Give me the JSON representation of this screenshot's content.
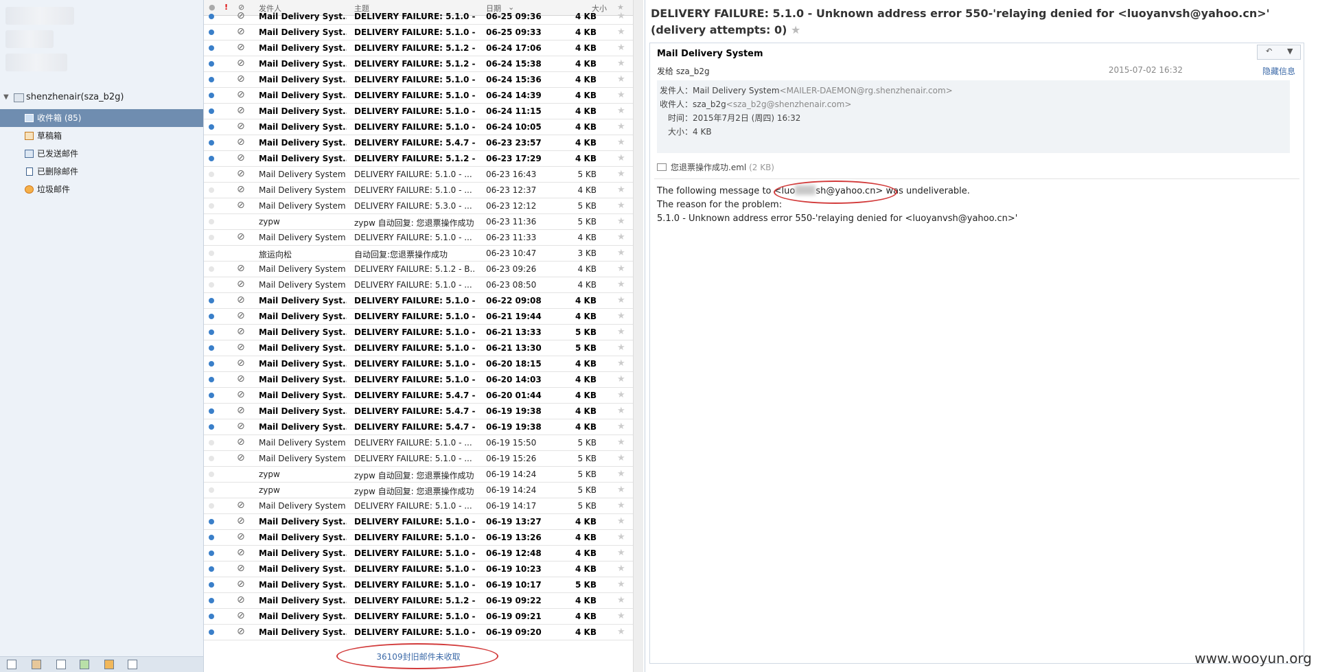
{
  "sidebar": {
    "account": "shenzhenair(sza_b2g)",
    "folders": [
      {
        "label": "收件箱 (85)",
        "icon": "inbox-icon",
        "selected": true
      },
      {
        "label": "草稿箱",
        "icon": "drafts-icon",
        "selected": false
      },
      {
        "label": "已发送邮件",
        "icon": "sent-icon",
        "selected": false
      },
      {
        "label": "已删除邮件",
        "icon": "trash-icon",
        "selected": false
      },
      {
        "label": "垃圾邮件",
        "icon": "junk-icon",
        "selected": false
      }
    ],
    "bottom_icons": [
      "mail-icon",
      "contacts-icon",
      "calendar-icon",
      "notes-icon",
      "rss-icon",
      "settings-icon"
    ]
  },
  "list": {
    "columns": {
      "from": "发件人",
      "subject": "主题",
      "date": "日期",
      "size": "大小"
    },
    "rows": [
      {
        "from": "Mail Delivery Syst...",
        "subject": "DELIVERY FAILURE: 5.1.0 - ...",
        "date": "06-25 09:36",
        "size": "4 KB",
        "unread": true,
        "attach": true
      },
      {
        "from": "Mail Delivery Syst...",
        "subject": "DELIVERY FAILURE: 5.1.0 - ...",
        "date": "06-25 09:33",
        "size": "4 KB",
        "unread": true,
        "attach": true
      },
      {
        "from": "Mail Delivery Syst...",
        "subject": "DELIVERY FAILURE: 5.1.2 - ...",
        "date": "06-24 17:06",
        "size": "4 KB",
        "unread": true,
        "attach": true
      },
      {
        "from": "Mail Delivery Syst...",
        "subject": "DELIVERY FAILURE: 5.1.2 - ...",
        "date": "06-24 15:38",
        "size": "4 KB",
        "unread": true,
        "attach": true
      },
      {
        "from": "Mail Delivery Syst...",
        "subject": "DELIVERY FAILURE: 5.1.0 - ...",
        "date": "06-24 15:36",
        "size": "4 KB",
        "unread": true,
        "attach": true
      },
      {
        "from": "Mail Delivery Syst...",
        "subject": "DELIVERY FAILURE: 5.1.0 - ...",
        "date": "06-24 14:39",
        "size": "4 KB",
        "unread": true,
        "attach": true
      },
      {
        "from": "Mail Delivery Syst...",
        "subject": "DELIVERY FAILURE: 5.1.0 - ...",
        "date": "06-24 11:15",
        "size": "4 KB",
        "unread": true,
        "attach": true
      },
      {
        "from": "Mail Delivery Syst...",
        "subject": "DELIVERY FAILURE: 5.1.0 - ...",
        "date": "06-24 10:05",
        "size": "4 KB",
        "unread": true,
        "attach": true
      },
      {
        "from": "Mail Delivery Syst...",
        "subject": "DELIVERY FAILURE: 5.4.7 - ...",
        "date": "06-23 23:57",
        "size": "4 KB",
        "unread": true,
        "attach": true
      },
      {
        "from": "Mail Delivery Syst...",
        "subject": "DELIVERY FAILURE: 5.1.2 - ...",
        "date": "06-23 17:29",
        "size": "4 KB",
        "unread": true,
        "attach": true
      },
      {
        "from": "Mail Delivery System",
        "subject": "DELIVERY FAILURE: 5.1.0 - ...",
        "date": "06-23 16:43",
        "size": "5 KB",
        "unread": false,
        "attach": true
      },
      {
        "from": "Mail Delivery System",
        "subject": "DELIVERY FAILURE: 5.1.0 - ...",
        "date": "06-23 12:37",
        "size": "4 KB",
        "unread": false,
        "attach": true
      },
      {
        "from": "Mail Delivery System",
        "subject": "DELIVERY FAILURE: 5.3.0 - ...",
        "date": "06-23 12:12",
        "size": "5 KB",
        "unread": false,
        "attach": true
      },
      {
        "from": "zypw",
        "subject": "zypw 自动回复: 您退票操作成功",
        "date": "06-23 11:36",
        "size": "5 KB",
        "unread": false,
        "attach": false
      },
      {
        "from": "Mail Delivery System",
        "subject": "DELIVERY FAILURE: 5.1.0 - ...",
        "date": "06-23 11:33",
        "size": "4 KB",
        "unread": false,
        "attach": true
      },
      {
        "from": "旅运向松",
        "subject": "自动回复:您退票操作成功",
        "date": "06-23 10:47",
        "size": "3 KB",
        "unread": false,
        "attach": false
      },
      {
        "from": "Mail Delivery System",
        "subject": "DELIVERY FAILURE: 5.1.2 - B...",
        "date": "06-23 09:26",
        "size": "4 KB",
        "unread": false,
        "attach": true
      },
      {
        "from": "Mail Delivery System",
        "subject": "DELIVERY FAILURE: 5.1.0 - ...",
        "date": "06-23 08:50",
        "size": "4 KB",
        "unread": false,
        "attach": true
      },
      {
        "from": "Mail Delivery Syst...",
        "subject": "DELIVERY FAILURE: 5.1.0 - ...",
        "date": "06-22 09:08",
        "size": "4 KB",
        "unread": true,
        "attach": true
      },
      {
        "from": "Mail Delivery Syst...",
        "subject": "DELIVERY FAILURE: 5.1.0 - ...",
        "date": "06-21 19:44",
        "size": "4 KB",
        "unread": true,
        "attach": true
      },
      {
        "from": "Mail Delivery Syst...",
        "subject": "DELIVERY FAILURE: 5.1.0 - ...",
        "date": "06-21 13:33",
        "size": "5 KB",
        "unread": true,
        "attach": true
      },
      {
        "from": "Mail Delivery Syst...",
        "subject": "DELIVERY FAILURE: 5.1.0 - ...",
        "date": "06-21 13:30",
        "size": "5 KB",
        "unread": true,
        "attach": true
      },
      {
        "from": "Mail Delivery Syst...",
        "subject": "DELIVERY FAILURE: 5.1.0 - ...",
        "date": "06-20 18:15",
        "size": "4 KB",
        "unread": true,
        "attach": true
      },
      {
        "from": "Mail Delivery Syst...",
        "subject": "DELIVERY FAILURE: 5.1.0 - ...",
        "date": "06-20 14:03",
        "size": "4 KB",
        "unread": true,
        "attach": true
      },
      {
        "from": "Mail Delivery Syst...",
        "subject": "DELIVERY FAILURE: 5.4.7 - ...",
        "date": "06-20 01:44",
        "size": "4 KB",
        "unread": true,
        "attach": true
      },
      {
        "from": "Mail Delivery Syst...",
        "subject": "DELIVERY FAILURE: 5.4.7 - ...",
        "date": "06-19 19:38",
        "size": "4 KB",
        "unread": true,
        "attach": true
      },
      {
        "from": "Mail Delivery Syst...",
        "subject": "DELIVERY FAILURE: 5.4.7 - ...",
        "date": "06-19 19:38",
        "size": "4 KB",
        "unread": true,
        "attach": true
      },
      {
        "from": "Mail Delivery System",
        "subject": "DELIVERY FAILURE: 5.1.0 - ...",
        "date": "06-19 15:50",
        "size": "5 KB",
        "unread": false,
        "attach": true
      },
      {
        "from": "Mail Delivery System",
        "subject": "DELIVERY FAILURE: 5.1.0 - ...",
        "date": "06-19 15:26",
        "size": "5 KB",
        "unread": false,
        "attach": true
      },
      {
        "from": "zypw",
        "subject": "zypw 自动回复: 您退票操作成功",
        "date": "06-19 14:24",
        "size": "5 KB",
        "unread": false,
        "attach": false
      },
      {
        "from": "zypw",
        "subject": "zypw 自动回复: 您退票操作成功",
        "date": "06-19 14:24",
        "size": "5 KB",
        "unread": false,
        "attach": false
      },
      {
        "from": "Mail Delivery System",
        "subject": "DELIVERY FAILURE: 5.1.0 - ...",
        "date": "06-19 14:17",
        "size": "5 KB",
        "unread": false,
        "attach": true
      },
      {
        "from": "Mail Delivery Syst...",
        "subject": "DELIVERY FAILURE: 5.1.0 - ...",
        "date": "06-19 13:27",
        "size": "4 KB",
        "unread": true,
        "attach": true
      },
      {
        "from": "Mail Delivery Syst...",
        "subject": "DELIVERY FAILURE: 5.1.0 - ...",
        "date": "06-19 13:26",
        "size": "4 KB",
        "unread": true,
        "attach": true
      },
      {
        "from": "Mail Delivery Syst...",
        "subject": "DELIVERY FAILURE: 5.1.0 - ...",
        "date": "06-19 12:48",
        "size": "4 KB",
        "unread": true,
        "attach": true
      },
      {
        "from": "Mail Delivery Syst...",
        "subject": "DELIVERY FAILURE: 5.1.0 - ...",
        "date": "06-19 10:23",
        "size": "4 KB",
        "unread": true,
        "attach": true
      },
      {
        "from": "Mail Delivery Syst...",
        "subject": "DELIVERY FAILURE: 5.1.0 - ...",
        "date": "06-19 10:17",
        "size": "5 KB",
        "unread": true,
        "attach": true
      },
      {
        "from": "Mail Delivery Syst...",
        "subject": "DELIVERY FAILURE: 5.1.2 - ...",
        "date": "06-19 09:22",
        "size": "4 KB",
        "unread": true,
        "attach": true
      },
      {
        "from": "Mail Delivery Syst...",
        "subject": "DELIVERY FAILURE: 5.1.0 - ...",
        "date": "06-19 09:21",
        "size": "4 KB",
        "unread": true,
        "attach": true
      },
      {
        "from": "Mail Delivery Syst...",
        "subject": "DELIVERY FAILURE: 5.1.0 - ...",
        "date": "06-19 09:20",
        "size": "4 KB",
        "unread": true,
        "attach": true
      }
    ],
    "footer": "36109封旧邮件未收取"
  },
  "reader": {
    "title": "DELIVERY FAILURE: 5.1.0 - Unknown address error 550-'relaying denied for <luoyanvsh@yahoo.cn>' (delivery attempts: 0)",
    "sender_name": "Mail Delivery System",
    "to_line": "发给 sza_b2g",
    "date": "2015-07-02 16:32",
    "hide_details": "隐藏信息",
    "from_label": "发件人：",
    "from_name": "Mail Delivery System",
    "from_addr": "<MAILER-DAEMON@rg.shenzhenair.com>",
    "to_label": "收件人：",
    "to_name": "sza_b2g",
    "to_addr": "<sza_b2g@shenzhenair.com>",
    "time_label": "时间：",
    "time_value": "2015年7月2日 (周四) 16:32",
    "size_label": "大小：",
    "size_value": "4 KB",
    "attachment_name": "您退票操作成功.eml",
    "attachment_size": "(2 KB)",
    "body_line1_a": "The following message to ",
    "body_line1_b": "<luo",
    "body_line1_c": "sh@yahoo.cn>",
    "body_line1_d": " was undeliverable.",
    "body_line2": "The reason for the problem:",
    "body_line3": "5.1.0 - Unknown address error 550-'relaying denied for <luoyanvsh@yahoo.cn>'"
  },
  "watermark": "www.wooyun.org"
}
